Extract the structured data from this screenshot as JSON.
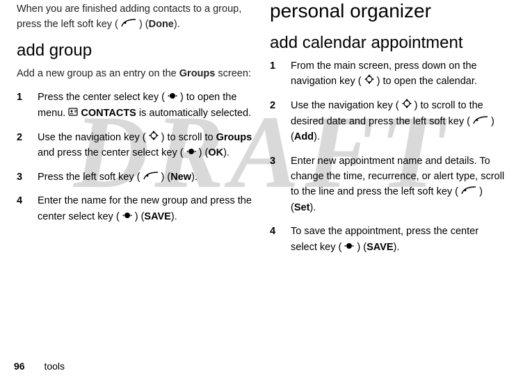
{
  "watermark": "DRAFT",
  "left": {
    "intro": {
      "pre": "When you are finished adding contacts to a group, press the left soft key (",
      "post": ") (",
      "label": "Done",
      "end": ")."
    },
    "heading": "add group",
    "subtext_pre": "Add a new group as an entry on the ",
    "subtext_bold": "Groups",
    "subtext_post": " screen:",
    "steps": [
      {
        "a": "Press the center select key (",
        "b": ") to open the menu. ",
        "c": "CONTACTS",
        "d": " is automatically selected."
      },
      {
        "a": "Use the navigation key (",
        "b": ") to scroll to ",
        "c": "Groups",
        "d": " and press the center select key (",
        "e": ") (",
        "f": "OK",
        "g": ")."
      },
      {
        "a": "Press the left soft key (",
        "b": ") (",
        "c": "New",
        "d": ")."
      },
      {
        "a": "Enter the name for the new group and press the center select key (",
        "b": ") (",
        "c": "SAVE",
        "d": ")."
      }
    ]
  },
  "right": {
    "title": "personal organizer",
    "heading": "add calendar appointment",
    "steps": [
      {
        "a": "From the main screen, press down on the navigation key (",
        "b": ") to open the calendar."
      },
      {
        "a": "Use the navigation key (",
        "b": ") to scroll to the desired date and press the left soft key (",
        "c": ") (",
        "d": "Add",
        "e": ")."
      },
      {
        "a": "Enter new appointment name and details. To change the time, recurrence, or alert type, scroll to the line and press the left soft key (",
        "b": ") (",
        "c": "Set",
        "d": ")."
      },
      {
        "a": "To save the appointment, press the center select key (",
        "b": ") (",
        "c": "SAVE",
        "d": ")."
      }
    ]
  },
  "footer": {
    "page": "96",
    "section": "tools"
  }
}
